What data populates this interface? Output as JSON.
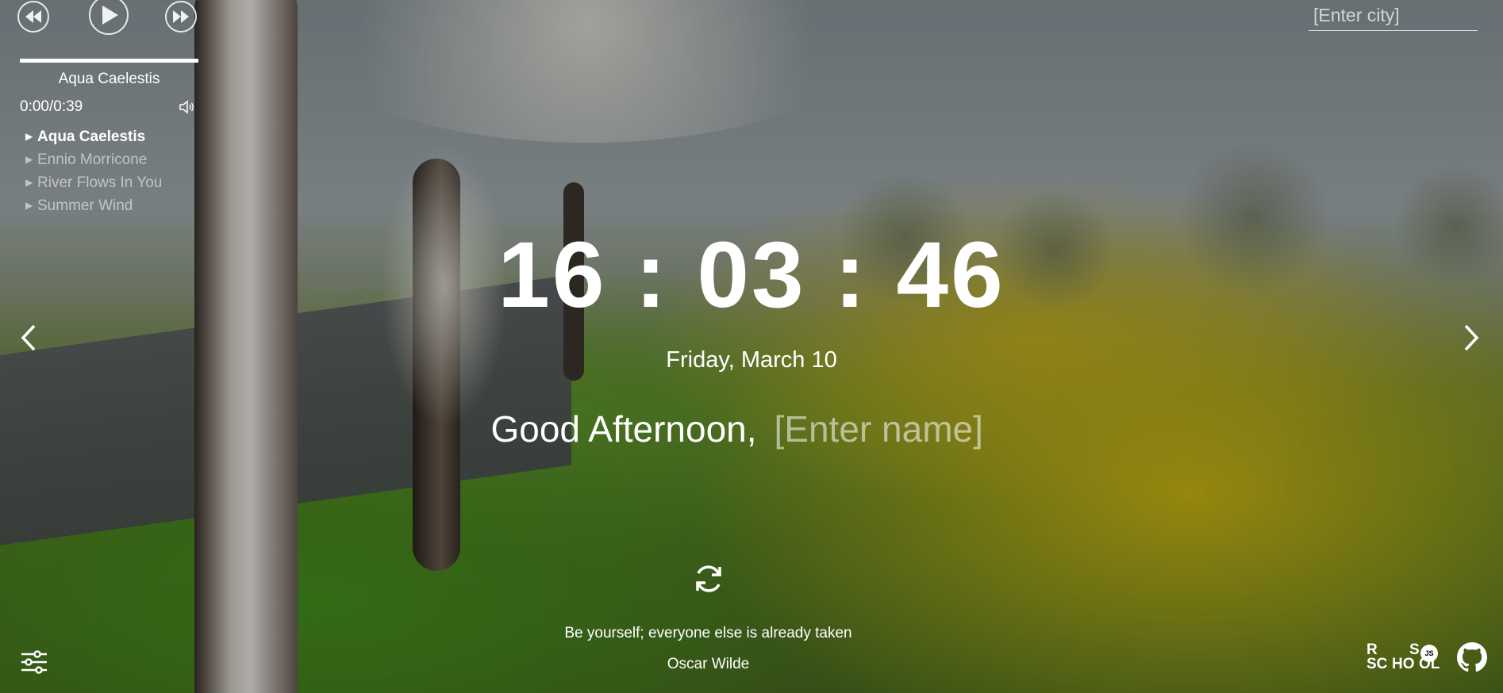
{
  "player": {
    "current_title": "Aqua Caelestis",
    "time": "0:00/0:39",
    "playlist": [
      {
        "label": "Aqua Caelestis",
        "active": true
      },
      {
        "label": "Ennio Morricone",
        "active": false
      },
      {
        "label": "River Flows In You",
        "active": false
      },
      {
        "label": "Summer Wind",
        "active": false
      }
    ],
    "icons": {
      "prev": "rewind-icon",
      "play": "play-icon",
      "next": "fast-forward-icon",
      "volume": "volume-icon"
    }
  },
  "weather": {
    "city_placeholder": "[Enter city]"
  },
  "clock": {
    "time": "16 : 03 : 46"
  },
  "date": {
    "text": "Friday, March 10"
  },
  "greeting": {
    "text": "Good Afternoon,",
    "name_placeholder": "[Enter name]"
  },
  "quote": {
    "text": "Be yourself; everyone else is already taken",
    "author": "Oscar Wilde",
    "refresh_icon": "refresh-icon"
  },
  "footer": {
    "settings_icon": "sliders-icon",
    "rss_logo": {
      "r": "R",
      "s": "S",
      "sc": "SC",
      "ho": "HO",
      "ol": "OL",
      "js": "JS"
    },
    "github_icon": "github-icon"
  },
  "colors": {
    "text": "#ffffff",
    "muted_text": "#b9b9b9"
  }
}
